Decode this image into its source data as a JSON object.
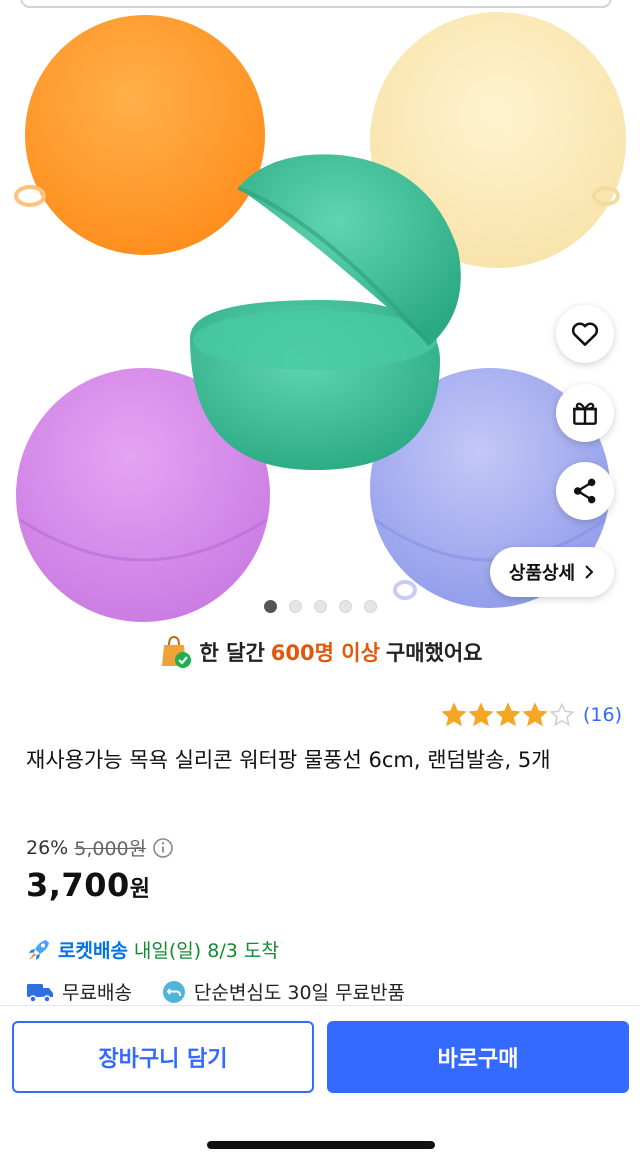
{
  "gallery": {
    "slide_count": 5,
    "active_slide": 1,
    "detail_button_label": "상품상세",
    "ball_colors": [
      "#ff9a2a",
      "#fbe8b5",
      "#3cc19a",
      "#d38be6",
      "#a6aef0"
    ]
  },
  "actions": {
    "wishlist_icon": "heart-icon",
    "gift_icon": "gift-icon",
    "share_icon": "share-icon"
  },
  "purchase_banner": {
    "prefix": "한 달간",
    "highlight": "600명 이상",
    "suffix": "구매했어요"
  },
  "rating": {
    "stars_filled": 4,
    "stars_total": 5,
    "count_text": "(16)"
  },
  "product": {
    "title": "재사용가능 목욕 실리콘 워터팡 물풍선 6cm, 랜덤발송, 5개",
    "discount_rate": "26%",
    "original_price": "5,000원",
    "price_number": "3,700",
    "price_unit": "원"
  },
  "delivery": {
    "rocket_label": "로켓배송",
    "arrival_text": "내일(일) 8/3 도착",
    "free_shipping": "무료배송",
    "return_policy": "단순변심도 30일 무료반품"
  },
  "bottom": {
    "cart_label": "장바구니 담기",
    "buy_label": "바로구매"
  },
  "colors": {
    "accent": "#346aff",
    "highlight": "#e3560b",
    "star": "#f5a623",
    "arrival": "#138a33"
  }
}
